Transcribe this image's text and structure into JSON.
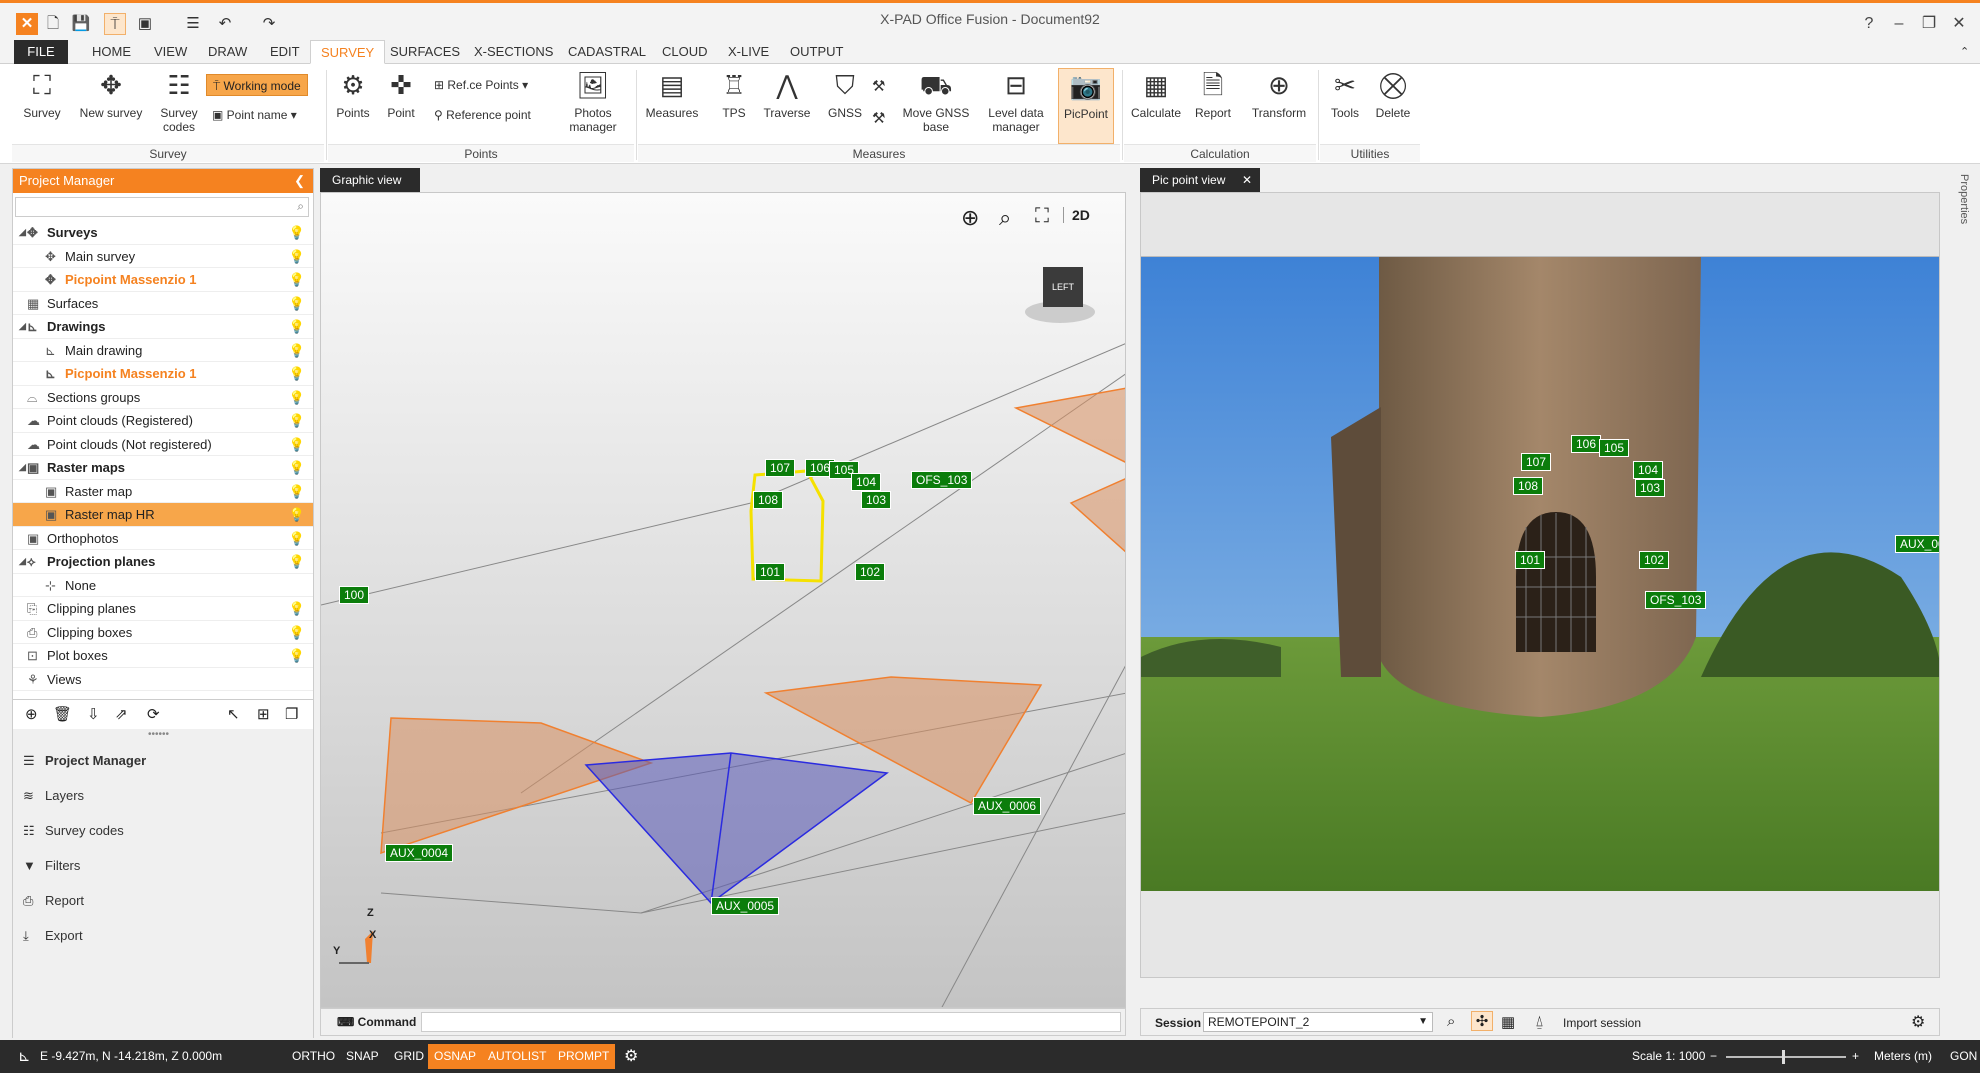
{
  "window": {
    "title": "X-PAD Office Fusion - Document92"
  },
  "tabs": [
    "FILE",
    "HOME",
    "VIEW",
    "DRAW",
    "EDIT",
    "SURVEY",
    "SURFACES",
    "X-SECTIONS",
    "CADASTRAL",
    "CLOUD",
    "X-LIVE",
    "OUTPUT"
  ],
  "ribbon": {
    "survey_btn": "Survey",
    "new_survey": "New survey",
    "survey_codes": "Survey codes",
    "working_mode": "Working mode",
    "point_name": "Point name",
    "points": "Points",
    "point": "Point",
    "refce_points": "Ref.ce Points",
    "reference_point": "Reference point",
    "photos_manager": "Photos manager",
    "measures": "Measures",
    "tps": "TPS",
    "traverse": "Traverse",
    "gnss": "GNSS",
    "move_gnss_base": "Move GNSS base",
    "level_data_manager": "Level data manager",
    "picpoint": "PicPoint",
    "calculate": "Calculate",
    "report": "Report",
    "transform": "Transform",
    "tools": "Tools",
    "delete": "Delete",
    "groups": {
      "survey": "Survey",
      "points": "Points",
      "measures": "Measures",
      "calculation": "Calculation",
      "utilities": "Utilities"
    }
  },
  "project_manager": {
    "title": "Project Manager",
    "tree": [
      {
        "label": "Surveys",
        "level": 0,
        "bold": true
      },
      {
        "label": "Main survey",
        "level": 1
      },
      {
        "label": "Picpoint Massenzio 1",
        "level": 1,
        "orange": true
      },
      {
        "label": "Surfaces",
        "level": 0
      },
      {
        "label": "Drawings",
        "level": 0,
        "bold": true
      },
      {
        "label": "Main drawing",
        "level": 1
      },
      {
        "label": "Picpoint Massenzio 1",
        "level": 1,
        "orange": true
      },
      {
        "label": "Sections groups",
        "level": 0
      },
      {
        "label": "Point clouds (Registered)",
        "level": 0
      },
      {
        "label": "Point clouds (Not registered)",
        "level": 0
      },
      {
        "label": "Raster maps",
        "level": 0,
        "bold": true
      },
      {
        "label": "Raster map",
        "level": 1
      },
      {
        "label": "Raster map HR",
        "level": 1,
        "selected": true
      },
      {
        "label": "Orthophotos",
        "level": 0
      },
      {
        "label": "Projection planes",
        "level": 0,
        "bold": true
      },
      {
        "label": "None",
        "level": 1
      },
      {
        "label": "Clipping planes",
        "level": 0
      },
      {
        "label": "Clipping boxes",
        "level": 0
      },
      {
        "label": "Plot boxes",
        "level": 0
      },
      {
        "label": "Views",
        "level": 0
      }
    ],
    "nav": [
      "Project Manager",
      "Layers",
      "Survey codes",
      "Filters",
      "Report",
      "Export"
    ]
  },
  "graphic_view": {
    "tab": "Graphic view",
    "view_mode": "2D",
    "cube_label": "LEFT",
    "axis_z": "Z",
    "axis_x": "X",
    "axis_y": "Y",
    "points": [
      "107",
      "106",
      "105",
      "104",
      "103",
      "108",
      "101",
      "102",
      "OFS_103",
      "100",
      "AUX_0004",
      "AUX_0005",
      "AUX_0006"
    ],
    "command_label": "Command"
  },
  "pic_view": {
    "tab": "Pic point view",
    "points": [
      "106",
      "105",
      "107",
      "104",
      "103",
      "108",
      "101",
      "102",
      "OFS_103",
      "AUX_00"
    ],
    "session_label": "Session",
    "session_value": "REMOTEPOINT_2",
    "import_session": "Import session"
  },
  "properties_label": "Properties",
  "status": {
    "coords": "E -9.427m, N -14.218m, Z 0.000m",
    "toggles": [
      {
        "label": "ORTHO",
        "on": false
      },
      {
        "label": "SNAP",
        "on": false
      },
      {
        "label": "GRID",
        "on": false
      },
      {
        "label": "OSNAP",
        "on": true
      },
      {
        "label": "AUTOLIST",
        "on": true
      },
      {
        "label": "PROMPT",
        "on": true
      }
    ],
    "scale": "Scale 1: 1000",
    "units": "Meters (m)",
    "angle": "GON"
  },
  "colors": {
    "accent": "#f58220",
    "dark": "#2b2b2b",
    "label_green": "#0b7d0b"
  }
}
